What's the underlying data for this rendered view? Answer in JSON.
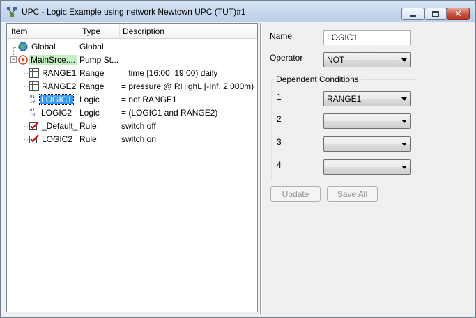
{
  "window": {
    "title": "UPC - Logic Example using network Newtown UPC (TUT)#1",
    "close_glyph": "✕"
  },
  "tree": {
    "columns": [
      "Item",
      "Type",
      "Description"
    ],
    "rows": [
      {
        "item": "Global",
        "type": "Global",
        "desc": "",
        "icon": "globe-icon"
      },
      {
        "item": "MainSrce....",
        "type": "Pump St...",
        "desc": "",
        "icon": "pump-station-icon",
        "expander": "−"
      },
      {
        "item": "RANGE1",
        "type": "Range",
        "desc": "= time [16:00, 19:00) daily",
        "icon": "range-grid-icon"
      },
      {
        "item": "RANGE2",
        "type": "Range",
        "desc": "= pressure @ RHighL [-Inf, 2.000m)",
        "icon": "range-grid-icon"
      },
      {
        "item": "LOGIC1",
        "type": "Logic",
        "desc": "= not RANGE1",
        "icon": "binary-logic-icon"
      },
      {
        "item": "LOGIC2",
        "type": "Logic",
        "desc": "= (LOGIC1 and RANGE2)",
        "icon": "binary-logic-icon"
      },
      {
        "item": "_Default_",
        "type": "Rule",
        "desc": "switch off",
        "icon": "rule-checkbox-icon"
      },
      {
        "item": "LOGIC2",
        "type": "Rule",
        "desc": "switch on",
        "icon": "rule-checkbox-icon"
      }
    ],
    "binary_glyph_top": "01",
    "binary_glyph_bottom": "10"
  },
  "form": {
    "name_label": "Name",
    "name_value": "LOGIC1",
    "operator_label": "Operator",
    "operator_value": "NOT",
    "group_title": "Dependent Conditions",
    "conditions": [
      {
        "label": "1",
        "value": "RANGE1"
      },
      {
        "label": "2",
        "value": ""
      },
      {
        "label": "3",
        "value": ""
      },
      {
        "label": "4",
        "value": ""
      }
    ],
    "update_label": "Update",
    "save_all_label": "Save All"
  },
  "colors": {
    "selection": "#3399ff",
    "hover_highlight": "#c4f0c4",
    "rule_check": "#cc0000",
    "pump_icon": "#e04010"
  }
}
